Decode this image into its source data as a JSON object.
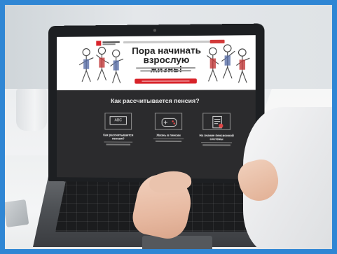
{
  "site": {
    "hero_title": "Пора начинать взрослую жизнь!",
    "section_title": "Как рассчитывается пенсия?",
    "cards": [
      {
        "icon": "chalkboard-icon",
        "icon_text": "ABC",
        "title": "Как рассчитывается пенсия?"
      },
      {
        "icon": "gamepad-icon",
        "title": "Жизнь в пенсии"
      },
      {
        "icon": "document-icon",
        "title": "На знание пенсионной системы"
      }
    ]
  },
  "colors": {
    "frame": "#2f86d4",
    "site_dark": "#2b2b2d",
    "accent": "#d8232a"
  }
}
